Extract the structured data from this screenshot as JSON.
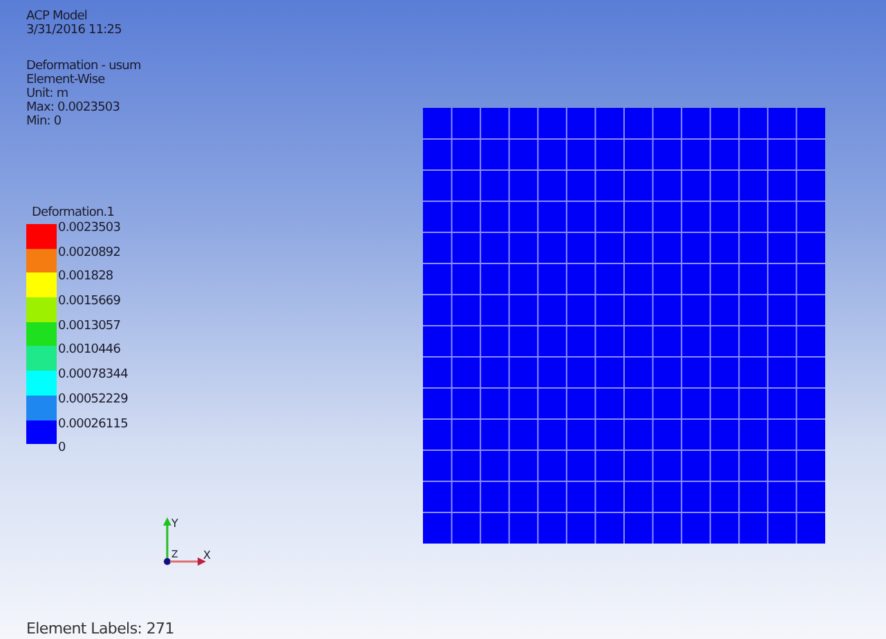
{
  "header": {
    "lines": [
      "ACP Model",
      "3/31/2016 11:25"
    ]
  },
  "result": {
    "lines": [
      "Deformation - usum",
      "Element-Wise",
      "Unit: m",
      "Max: 0.0023503",
      "Min: 0"
    ]
  },
  "legend": {
    "title": "Deformation.1",
    "bottom_label": "0",
    "bands": [
      {
        "label": "0.0023503",
        "color": "#ff0000"
      },
      {
        "label": "0.0020892",
        "color": "#f47c10"
      },
      {
        "label": "0.001828",
        "color": "#ffff00"
      },
      {
        "label": "0.0015669",
        "color": "#9cf000"
      },
      {
        "label": "0.0013057",
        "color": "#1ee01e"
      },
      {
        "label": "0.0010446",
        "color": "#1ee88a"
      },
      {
        "label": "0.00078344",
        "color": "#00ffff"
      },
      {
        "label": "0.00052229",
        "color": "#1e88f0"
      },
      {
        "label": "0.00026115",
        "color": "#0000ff"
      }
    ]
  },
  "triad": {
    "axes": [
      {
        "kind": "y",
        "label": "Y"
      },
      {
        "kind": "z",
        "label": "Z"
      },
      {
        "kind": "x",
        "label": "X"
      }
    ]
  },
  "status": "Element Labels: 271"
}
